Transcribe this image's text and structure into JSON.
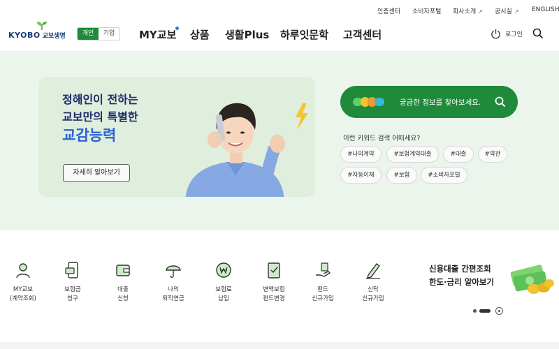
{
  "util_links": {
    "cert": "인증센터",
    "consumer": "소비자포털",
    "about": "회사소개",
    "disclosure": "공시실",
    "english": "ENGLISH",
    "external_glyph": "↗"
  },
  "header": {
    "logo_en": "KYOBO",
    "logo_kr": "교보생명",
    "segment": {
      "personal": "개인",
      "corporate": "기업",
      "selected": "개인"
    },
    "nav": [
      "MY교보",
      "상품",
      "생활Plus",
      "하루잇문학",
      "고객센터"
    ],
    "login": "로그인"
  },
  "banner": {
    "line1": "정해인이 전하는",
    "line2": "교보만의 특별한",
    "line3": "교감능력",
    "button": "자세히 알아보기"
  },
  "search": {
    "placeholder": "궁금한 정보를 찾아보세요.",
    "keyword_title": "이런 키워드 검색 어떠세요?",
    "keywords": [
      "#나의계약",
      "#보험계약대출",
      "#대출",
      "#약관",
      "#자동이체",
      "#보험",
      "#소비자포털"
    ]
  },
  "quick_menu": [
    {
      "label": "MY교보\n(계약조회)",
      "icon": "person-card-icon"
    },
    {
      "label": "보험금\n청구",
      "icon": "phone-money-icon"
    },
    {
      "label": "대출\n신청",
      "icon": "wallet-icon"
    },
    {
      "label": "나의\n퇴직연금",
      "icon": "umbrella-icon"
    },
    {
      "label": "보험료\n납입",
      "icon": "won-coin-icon"
    },
    {
      "label": "변액보험\n펀드변경",
      "icon": "checklist-icon"
    },
    {
      "label": "펀드\n신규가입",
      "icon": "hand-money-icon"
    },
    {
      "label": "신탁\n신규가입",
      "icon": "pen-sign-icon"
    }
  ],
  "loan_promo": {
    "line1": "신용대출 간편조회",
    "line2": "한도·금리 알아보기"
  },
  "colors": {
    "brand_green": "#1e8a3a",
    "hero_bg": "#ebf5ec",
    "banner_title": "#1f2a6b",
    "banner_accent": "#2a62d6"
  }
}
